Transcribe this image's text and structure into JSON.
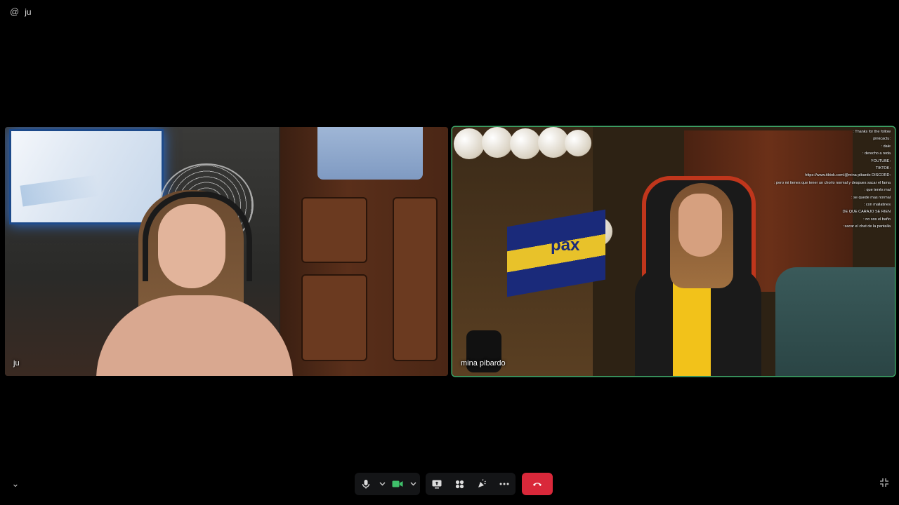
{
  "header": {
    "channel_icon": "at-icon",
    "channel_name": "ju"
  },
  "participants": [
    {
      "name": "ju",
      "speaking": false
    },
    {
      "name": "mina pibardo",
      "speaking": true,
      "speaking_color": "#3fa86a"
    }
  ],
  "stream_overlay": {
    "flag_logo": "pax",
    "chat_lines": [
      ": Thanks for the follow",
      "pinkcactu:",
      ": dale",
      ": derecho a reda",
      "YOUTUBE:",
      "TIKTOK:",
      "https://www.tiktok.com/@mina pibardo DISCORD:",
      ": pero mi tienes que tener un chorlo normal y despues sacar el fama",
      ": que tenés mal",
      ": se quede mas normal",
      ": con mallatines",
      "DE QUE CARAJO SE RIEN",
      ": no sos el baño",
      ": sacar el chat de la pantalla"
    ]
  },
  "controls": {
    "mic_icon": "microphone-icon",
    "camera_icon": "video-camera-icon",
    "camera_active_color": "#3fbf6a",
    "screen_share_icon": "screen-share-icon",
    "activities_icon": "activities-icon",
    "soundboard_icon": "soundboard-icon",
    "more_icon": "more-options-icon",
    "leave_icon": "hang-up-icon",
    "leave_color": "#d9283a",
    "collapse_icon": "chevron-down-icon",
    "fullscreen_icon": "exit-fullscreen-icon"
  }
}
